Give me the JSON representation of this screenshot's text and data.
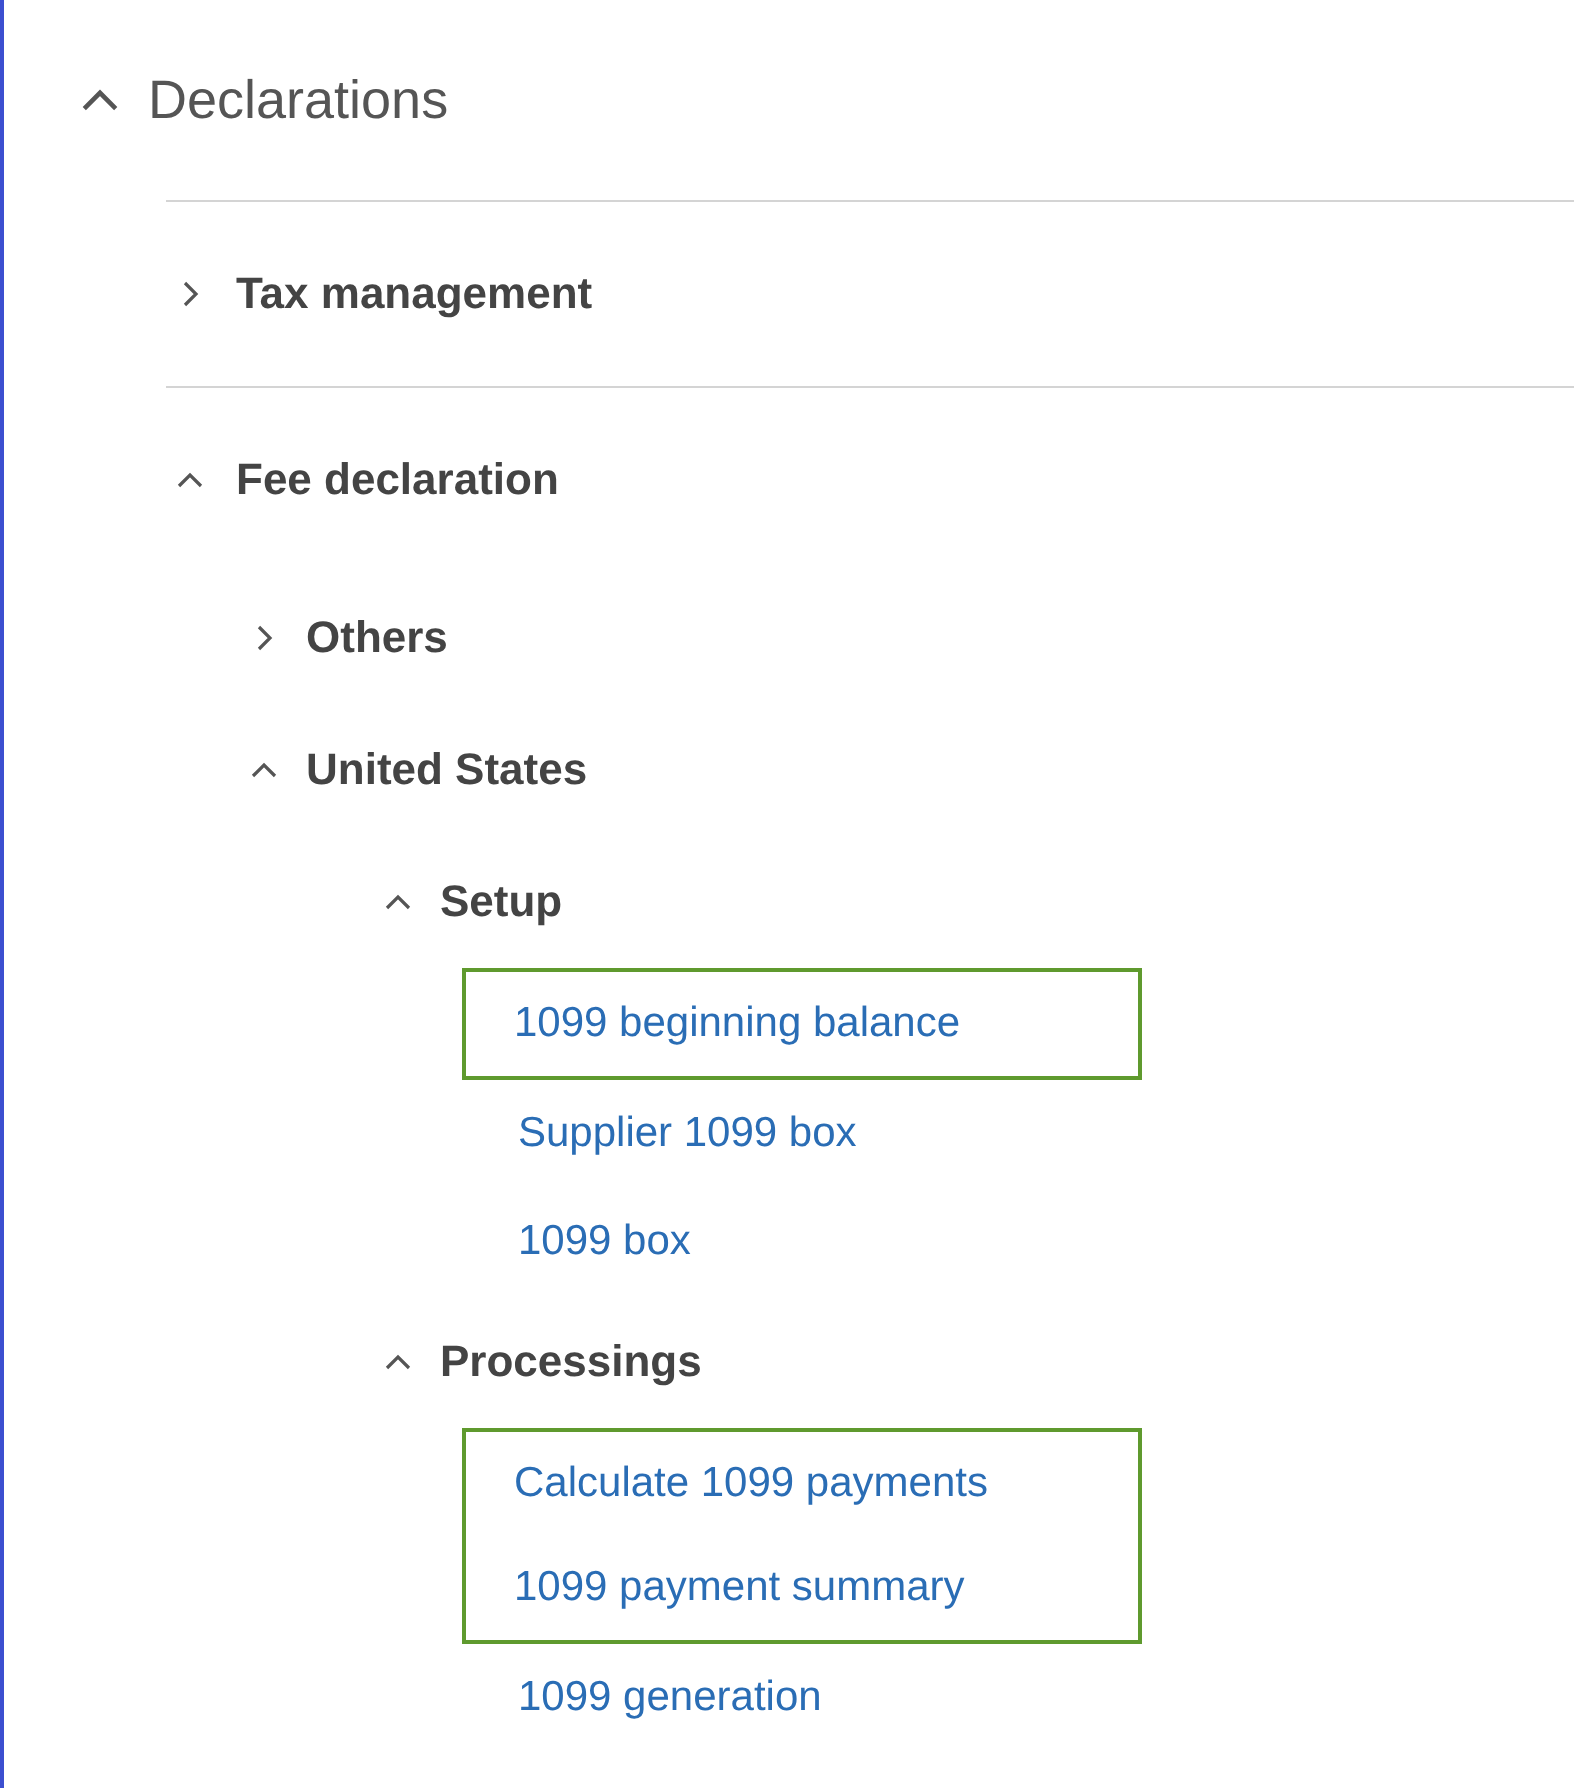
{
  "tree": [
    {
      "label": "Declarations",
      "kind": "group",
      "expanded": true,
      "children": [
        {
          "label": "Tax management",
          "kind": "group",
          "expanded": false
        },
        {
          "label": "Fee declaration",
          "kind": "group",
          "expanded": true,
          "children": [
            {
              "label": "Others",
              "kind": "group",
              "expanded": false
            },
            {
              "label": "United States",
              "kind": "group",
              "expanded": true,
              "children": [
                {
                  "label": "Setup",
                  "kind": "group",
                  "expanded": true,
                  "children": [
                    {
                      "label": "1099 beginning balance",
                      "kind": "link",
                      "highlighted": true
                    },
                    {
                      "label": "Supplier 1099 box",
                      "kind": "link",
                      "highlighted": false
                    },
                    {
                      "label": "1099 box",
                      "kind": "link",
                      "highlighted": false
                    }
                  ]
                },
                {
                  "label": "Processings",
                  "kind": "group",
                  "expanded": true,
                  "children": [
                    {
                      "label": "Calculate 1099 payments",
                      "kind": "link",
                      "highlighted": true
                    },
                    {
                      "label": "1099 payment summary",
                      "kind": "link",
                      "highlighted": true
                    },
                    {
                      "label": "1099 generation",
                      "kind": "link",
                      "highlighted": false
                    }
                  ]
                }
              ]
            }
          ]
        }
      ]
    }
  ]
}
